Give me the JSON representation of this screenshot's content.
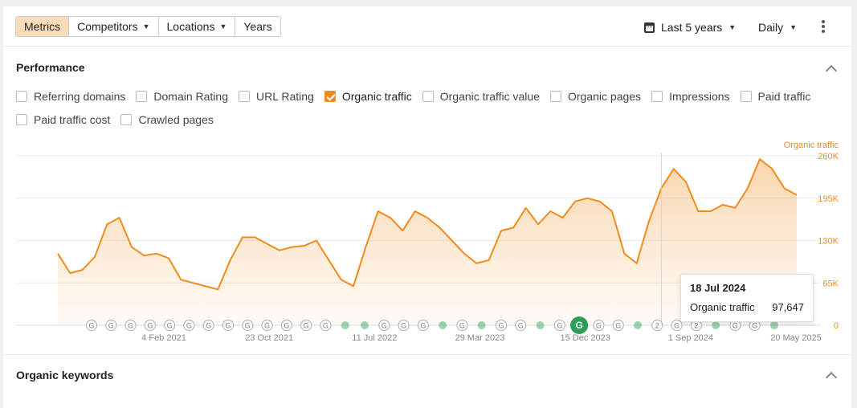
{
  "toolbar": {
    "tabs": [
      {
        "label": "Metrics",
        "active": true,
        "dropdown": false
      },
      {
        "label": "Competitors",
        "active": false,
        "dropdown": true
      },
      {
        "label": "Locations",
        "active": false,
        "dropdown": true
      },
      {
        "label": "Years",
        "active": false,
        "dropdown": false
      }
    ],
    "range_label": "Last 5 years",
    "interval_label": "Daily"
  },
  "performance": {
    "title": "Performance",
    "metrics": [
      {
        "label": "Referring domains",
        "checked": false
      },
      {
        "label": "Domain Rating",
        "checked": false
      },
      {
        "label": "URL Rating",
        "checked": false
      },
      {
        "label": "Organic traffic",
        "checked": true
      },
      {
        "label": "Organic traffic value",
        "checked": false
      },
      {
        "label": "Organic pages",
        "checked": false
      },
      {
        "label": "Impressions",
        "checked": false
      },
      {
        "label": "Paid traffic",
        "checked": false
      },
      {
        "label": "Paid traffic cost",
        "checked": false
      },
      {
        "label": "Crawled pages",
        "checked": false
      }
    ]
  },
  "tooltip": {
    "date": "18 Jul 2024",
    "metric": "Organic traffic",
    "value": "97,647"
  },
  "organic_keywords": {
    "title": "Organic keywords"
  },
  "colors": {
    "accent": "#f08c1c",
    "active_tab_bg": "#fbdcb8",
    "marker_green": "#4caf70"
  },
  "chart_data": {
    "type": "area",
    "series_name": "Organic traffic",
    "x_tick_labels": [
      "4 Feb 2021",
      "23 Oct 2021",
      "11 Jul 2022",
      "29 Mar 2023",
      "15 Dec 2023",
      "1 Sep 2024",
      "20 May 2025"
    ],
    "y_tick_labels": [
      "260K",
      "195K",
      "130K",
      "65K",
      "0"
    ],
    "ylim": [
      0,
      260000
    ],
    "y_axis_position": "right",
    "grid": true,
    "x": [
      "2020-06",
      "2020-07",
      "2020-08",
      "2020-09",
      "2020-10",
      "2020-11",
      "2020-12",
      "2021-01",
      "2021-02",
      "2021-03",
      "2021-04",
      "2021-05",
      "2021-06",
      "2021-07",
      "2021-08",
      "2021-09",
      "2021-10",
      "2021-11",
      "2021-12",
      "2022-01",
      "2022-02",
      "2022-03",
      "2022-04",
      "2022-05",
      "2022-06",
      "2022-07",
      "2022-08",
      "2022-09",
      "2022-10",
      "2022-11",
      "2022-12",
      "2023-01",
      "2023-02",
      "2023-03",
      "2023-04",
      "2023-05",
      "2023-06",
      "2023-07",
      "2023-08",
      "2023-09",
      "2023-10",
      "2023-11",
      "2023-12",
      "2024-01",
      "2024-02",
      "2024-03",
      "2024-04",
      "2024-05",
      "2024-06",
      "2024-07",
      "2024-08",
      "2024-09",
      "2024-10",
      "2024-11",
      "2024-12",
      "2025-01",
      "2025-02",
      "2025-03",
      "2025-04",
      "2025-05",
      "2025-06"
    ],
    "values": [
      110000,
      80000,
      85000,
      105000,
      155000,
      165000,
      120000,
      107000,
      110000,
      103000,
      70000,
      65000,
      60000,
      55000,
      100000,
      135000,
      135000,
      125000,
      115000,
      120000,
      122000,
      130000,
      100000,
      70000,
      60000,
      120000,
      175000,
      165000,
      145000,
      175000,
      165000,
      150000,
      130000,
      110000,
      95000,
      100000,
      145000,
      150000,
      180000,
      155000,
      175000,
      165000,
      190000,
      195000,
      190000,
      175000,
      110000,
      95000,
      160000,
      210000,
      240000,
      220000,
      175000,
      175000,
      185000,
      180000,
      210000,
      255000,
      240000,
      210000,
      200000
    ],
    "event_markers": [
      {
        "label": "G",
        "type": "update"
      },
      {
        "label": "G",
        "type": "update"
      },
      {
        "label": "G",
        "type": "update"
      },
      {
        "label": "G",
        "type": "update"
      },
      {
        "label": "G",
        "type": "update"
      },
      {
        "label": "G",
        "type": "update"
      },
      {
        "label": "G",
        "type": "update"
      },
      {
        "label": "G",
        "type": "update"
      },
      {
        "label": "G",
        "type": "update"
      },
      {
        "label": "G",
        "type": "update"
      },
      {
        "label": "G",
        "type": "update"
      },
      {
        "label": "G",
        "type": "update"
      },
      {
        "label": "G",
        "type": "update"
      },
      {
        "label": "",
        "type": "dot"
      },
      {
        "label": "",
        "type": "dot"
      },
      {
        "label": "G",
        "type": "update"
      },
      {
        "label": "G",
        "type": "update"
      },
      {
        "label": "G",
        "type": "update"
      },
      {
        "label": "",
        "type": "dot"
      },
      {
        "label": "G",
        "type": "update"
      },
      {
        "label": "",
        "type": "dot"
      },
      {
        "label": "G",
        "type": "update"
      },
      {
        "label": "G",
        "type": "update"
      },
      {
        "label": "",
        "type": "dot"
      },
      {
        "label": "G",
        "type": "update"
      },
      {
        "label": "G",
        "type": "highlight"
      },
      {
        "label": "G",
        "type": "update"
      },
      {
        "label": "G",
        "type": "update"
      },
      {
        "label": "",
        "type": "dot"
      },
      {
        "label": "2",
        "type": "update"
      },
      {
        "label": "G",
        "type": "update"
      },
      {
        "label": "2",
        "type": "update"
      },
      {
        "label": "",
        "type": "dot"
      },
      {
        "label": "G",
        "type": "update"
      },
      {
        "label": "G",
        "type": "update"
      },
      {
        "label": "",
        "type": "dot"
      }
    ]
  }
}
